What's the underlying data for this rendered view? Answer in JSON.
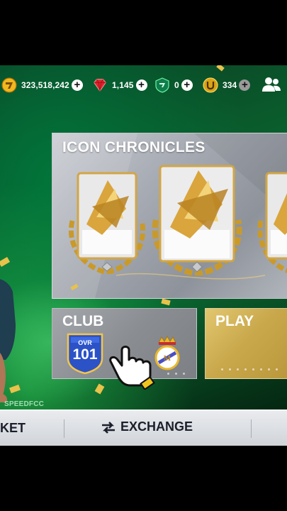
{
  "currencies": [
    {
      "name": "coins",
      "value": "323,518,242",
      "icon": "coin-icon",
      "has_plus": true
    },
    {
      "name": "gems",
      "value": "1,145",
      "icon": "gem-icon",
      "has_plus": true
    },
    {
      "name": "tokens",
      "value": "0",
      "icon": "token-icon",
      "has_plus": true
    },
    {
      "name": "u-points",
      "value": "334",
      "icon": "u-coin-icon",
      "has_plus": true
    }
  ],
  "plus_label": "+",
  "panel": {
    "title": "ICON CHRONICLES"
  },
  "club": {
    "label": "CLUB",
    "ovr_label": "OVR",
    "ovr_value": "101"
  },
  "play": {
    "label": "PLAY"
  },
  "watermark": "SPEEDFCC",
  "nav": {
    "left_partial": "KET",
    "exchange": "EXCHANGE"
  },
  "colors": {
    "gold": "#e8c24a",
    "pitch_green": "#0a5a2c",
    "nav_bg": "#e0e3e7",
    "nav_text": "#1b1f2b"
  }
}
